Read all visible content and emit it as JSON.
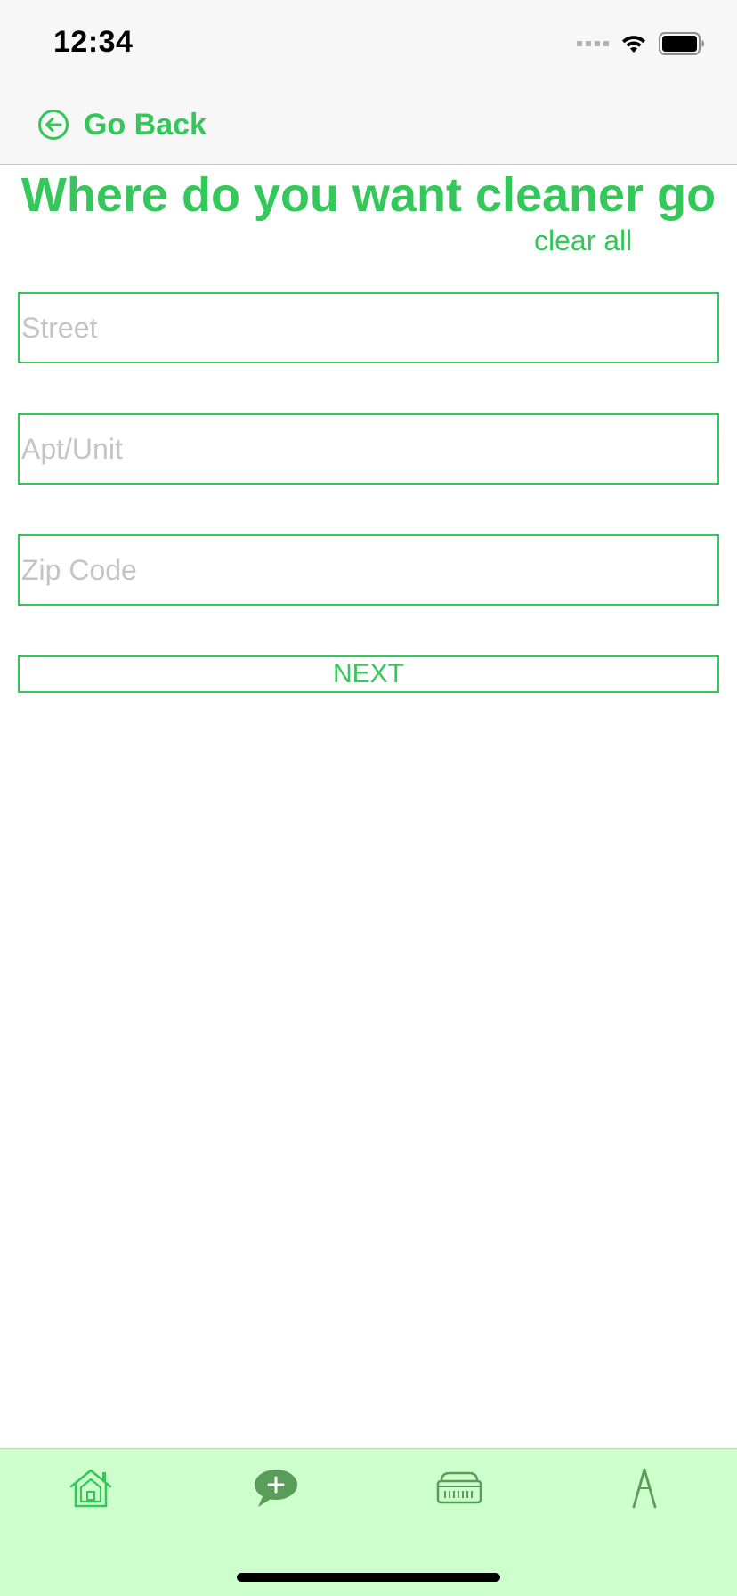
{
  "status_bar": {
    "time": "12:34"
  },
  "nav": {
    "back_label": "Go Back",
    "back_icon": "arrow-left-circle-icon"
  },
  "page": {
    "title": "Where do you want cleaner go",
    "clear_all_label": "clear all"
  },
  "form": {
    "street": {
      "placeholder": "Street",
      "value": ""
    },
    "apt": {
      "placeholder": "Apt/Unit",
      "value": ""
    },
    "zip": {
      "placeholder": "Zip Code",
      "value": ""
    },
    "next_label": "NEXT"
  },
  "tab_bar": {
    "items": [
      {
        "icon": "home-icon"
      },
      {
        "icon": "chat-add-icon"
      },
      {
        "icon": "heater-icon"
      },
      {
        "icon": "compass-icon"
      }
    ]
  },
  "colors": {
    "accent": "#34c759",
    "tab_bar_bg": "#ccffcc",
    "tab_icon": "#5a9c5a",
    "placeholder": "#c4c4c4",
    "header_bg": "#f7f7f7"
  }
}
